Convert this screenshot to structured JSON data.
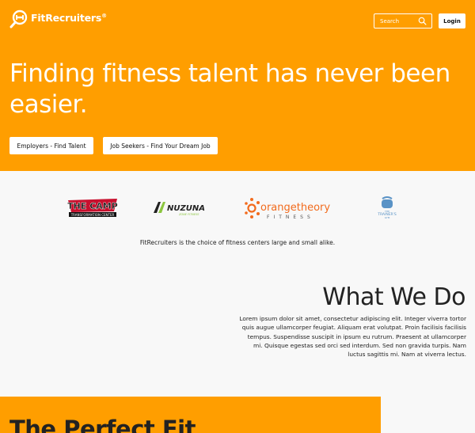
{
  "header": {
    "logo_text": "FitRecruiters",
    "logo_reg": "®",
    "search_placeholder": "Search",
    "login_label": "Login"
  },
  "hero": {
    "title": "Finding fitness talent has never been easier.",
    "employers_button": "Employers - Find Talent",
    "seekers_button": "Job Seekers - Find Your Dream Job"
  },
  "partners": {
    "logos": [
      {
        "name": "The Camp",
        "line1": "THE CAMP",
        "line2": "TRANSFORMATION CENTER"
      },
      {
        "name": "Nuzuna",
        "line1": "NUZUNA",
        "line2": "ZONE FITNESS"
      },
      {
        "name": "Orangetheory Fitness",
        "line1": "orangetheory",
        "line2": "FITNESS"
      },
      {
        "name": "The Trainer's Gym",
        "line1": "THE",
        "line2": "TRAINER'S",
        "line3": "GYM"
      }
    ],
    "tagline": "FitRecruiters is the choice of fitness centers large and small alike."
  },
  "what_we_do": {
    "title": "What We Do",
    "body": "Lorem ipsum dolor sit amet, consectetur adipiscing elit. Integer viverra tortor quis augue ullamcorper feugiat. Aliquam erat volutpat. Proin facilisis facilisis tempus. Suspendisse suscipit in ipsum eu rutrum. Praesent at ullamcorper mi. Quisque egestas sed orci sed interdum. Sed non gravida turpis. Nam luctus sagittis mi. Nam at viverra lectus."
  },
  "perfect_fit": {
    "title": "The Perfect Fit"
  },
  "colors": {
    "brand_orange": "#ff9e00",
    "text_dark": "#222222",
    "white": "#ffffff",
    "camp_red": "#c8102e",
    "nuzuna_green": "#8cc63f",
    "orangetheory_orange": "#f26b1d",
    "trainers_blue": "#5a93c6"
  }
}
